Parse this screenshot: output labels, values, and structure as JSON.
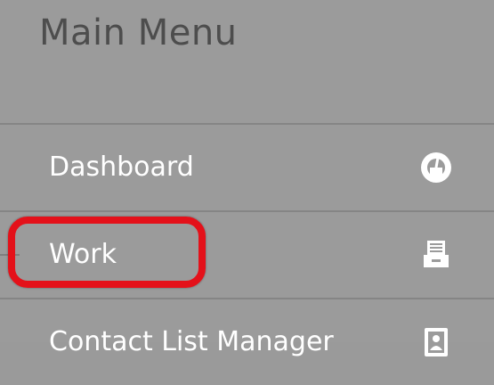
{
  "menu": {
    "title": "Main Menu",
    "items": [
      {
        "label": "Dashboard",
        "icon": "dashboard-gauge-icon"
      },
      {
        "label": "Work",
        "icon": "inbox-tray-icon"
      },
      {
        "label": "Contact List Manager",
        "icon": "contact-card-icon"
      }
    ]
  },
  "colors": {
    "background": "#9b9b9b",
    "title_text": "#4d4d4d",
    "item_text": "#ffffff",
    "divider": "#858585",
    "highlight": "#e4111a"
  }
}
